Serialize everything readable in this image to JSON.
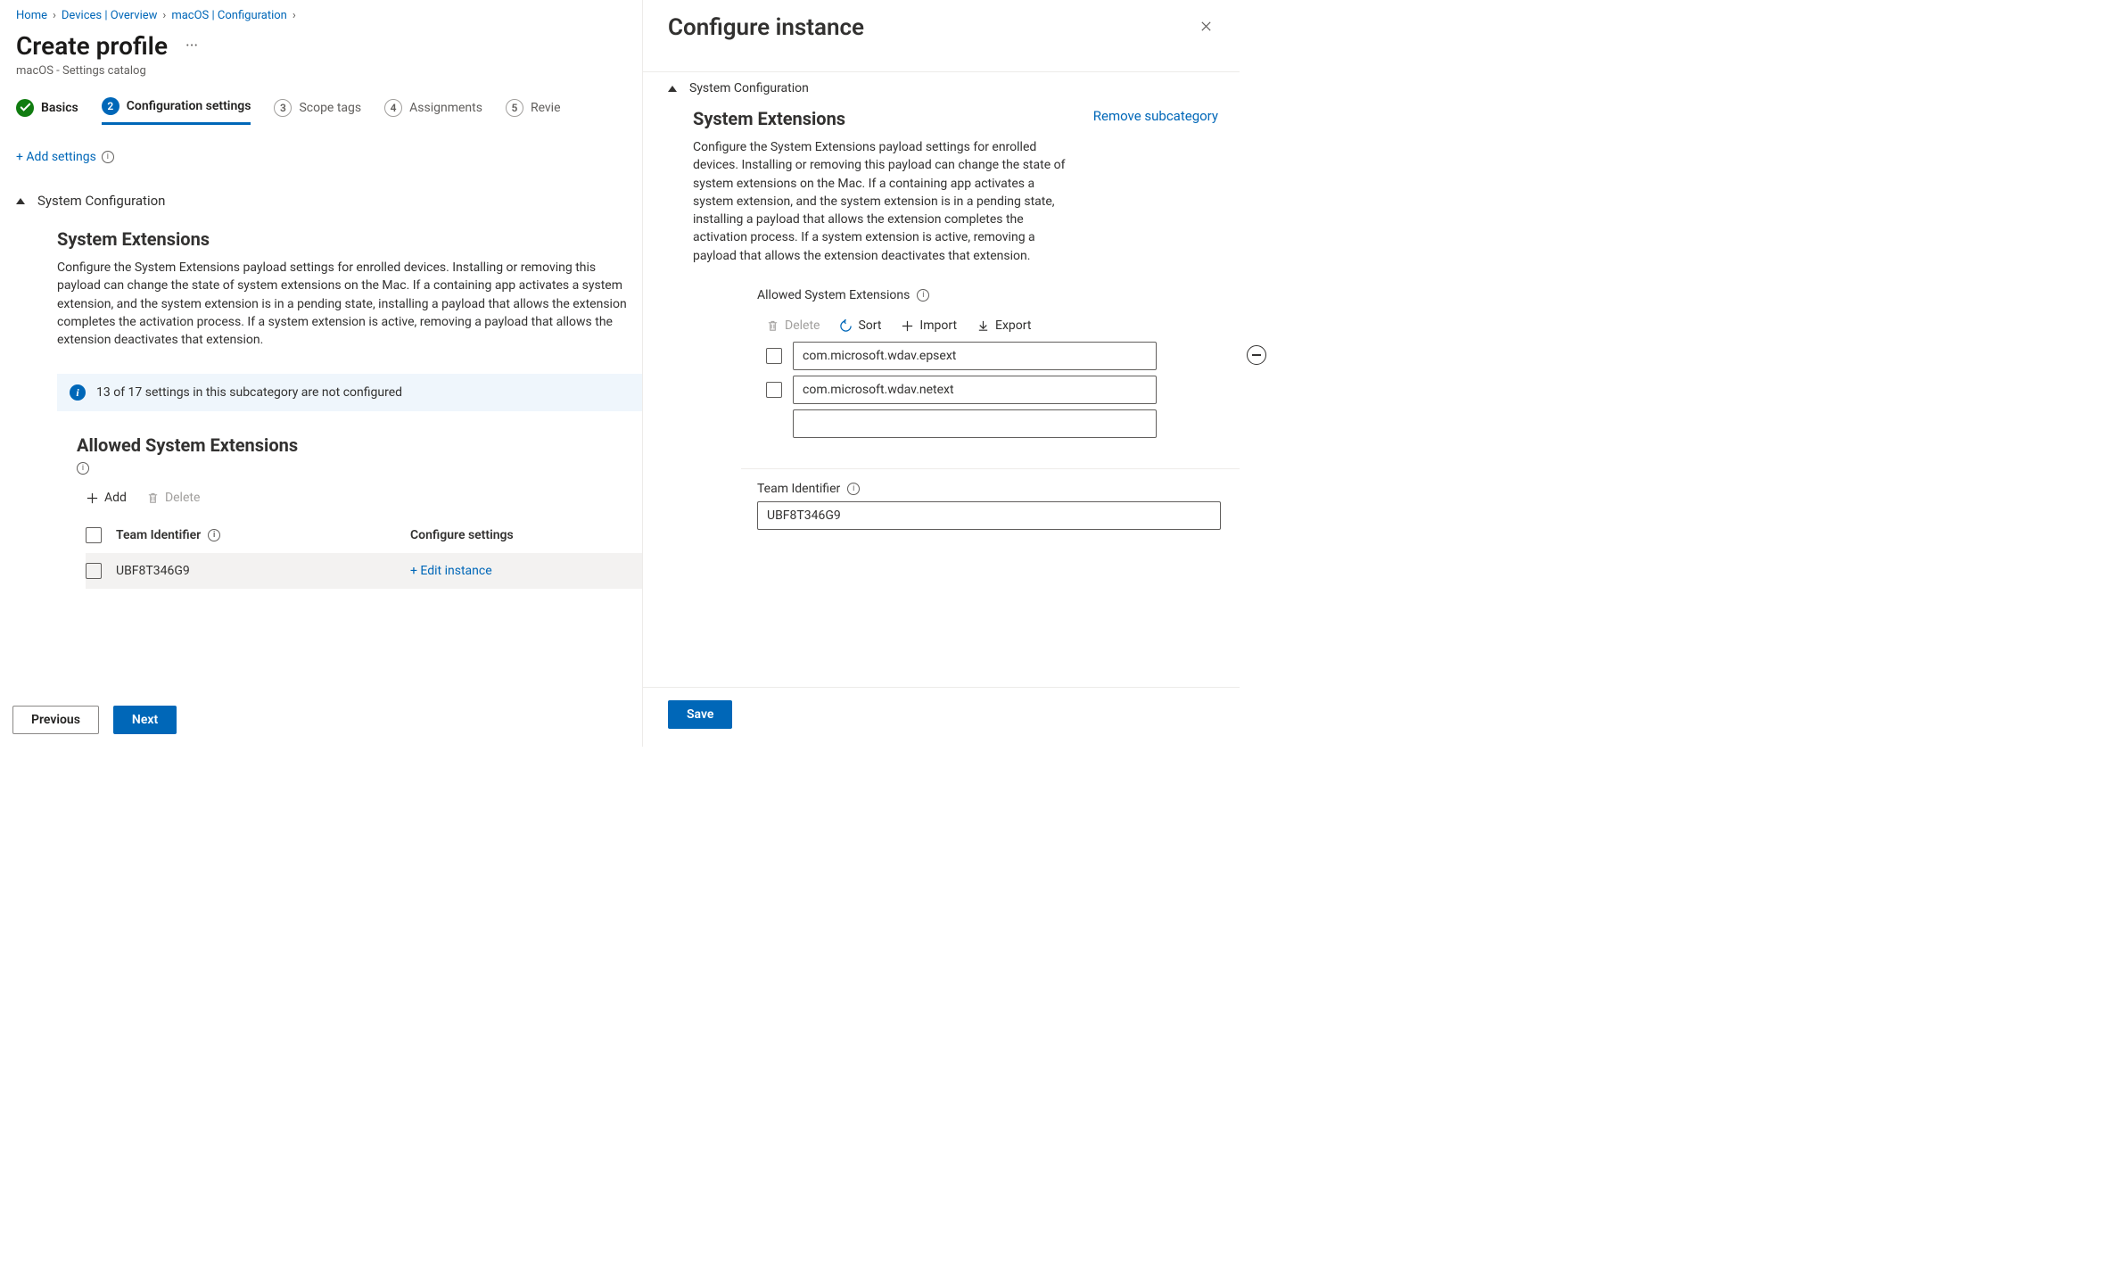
{
  "breadcrumb": [
    {
      "label": "Home"
    },
    {
      "label": "Devices | Overview"
    },
    {
      "label": "macOS | Configuration"
    }
  ],
  "page_title": "Create profile",
  "page_subtitle": "macOS - Settings catalog",
  "steps": [
    {
      "label": "Basics",
      "state": "done"
    },
    {
      "label": "Configuration settings",
      "state": "current",
      "num": "2"
    },
    {
      "label": "Scope tags",
      "state": "upcoming",
      "num": "3"
    },
    {
      "label": "Assignments",
      "state": "upcoming",
      "num": "4"
    },
    {
      "label": "Revie",
      "state": "upcoming",
      "num": "5"
    }
  ],
  "add_settings_label": "+ Add settings",
  "section_title": "System Configuration",
  "subcat_title": "System Extensions",
  "subcat_desc": "Configure the System Extensions payload settings for enrolled devices. Installing or removing this payload can change the state of system extensions on the Mac. If a containing app activates a system extension, and the system extension is in a pending state, installing a payload that allows the extension completes the activation process. If a system extension is active, removing a payload that allows the extension deactivates that extension.",
  "notice_text": "13 of 17 settings in this subcategory are not configured",
  "allowed_title": "Allowed System Extensions",
  "toolbar": {
    "add": "Add",
    "delete": "Delete"
  },
  "table": {
    "col_team": "Team Identifier",
    "col_conf": "Configure settings",
    "rows": [
      {
        "team": "UBF8T346G9",
        "action": "+ Edit instance"
      }
    ]
  },
  "buttons": {
    "previous": "Previous",
    "next": "Next"
  },
  "panel": {
    "title": "Configure instance",
    "section_title": "System Configuration",
    "subcat_title": "System Extensions",
    "remove_link": "Remove subcategory",
    "desc": "Configure the System Extensions payload settings for enrolled devices. Installing or removing this payload can change the state of system extensions on the Mac. If a containing app activates a system extension, and the system extension is in a pending state, installing a payload that allows the extension completes the activation process. If a system extension is active, removing a payload that allows the extension deactivates that extension.",
    "field_allowed": "Allowed System Extensions",
    "toolbar": {
      "delete": "Delete",
      "sort": "Sort",
      "import": "Import",
      "export": "Export"
    },
    "ext_list": [
      "com.microsoft.wdav.epsext",
      "com.microsoft.wdav.netext",
      ""
    ],
    "team_label": "Team Identifier",
    "team_value": "UBF8T346G9",
    "save": "Save"
  }
}
